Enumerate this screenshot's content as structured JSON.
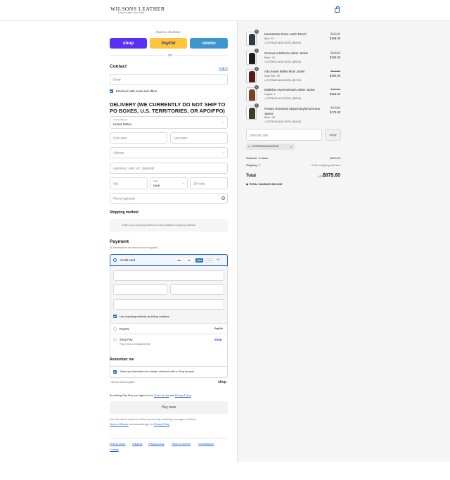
{
  "header": {
    "brand": "WILSONS LEATHER",
    "tagline": "Leather Made. Since 1899"
  },
  "express": {
    "title": "Express checkout",
    "shop": "shop",
    "paypal": "PayPal",
    "venmo": "venmo",
    "or": "OR"
  },
  "contact": {
    "title": "Contact",
    "login": "Log in",
    "email_placeholder": "Email",
    "email_news": "Email me with news and offers"
  },
  "delivery": {
    "title_line1": "DELIVERY (WE CURRENTLY DO NOT SHIP TO",
    "title_line2": "PO BOXES, U.S. TERRITORIES, OR APO/FPO)",
    "country_label": "Country/Region",
    "country_value": "United States",
    "first_name": "First name",
    "last_name": "Last name",
    "address": "Address",
    "apartment": "Apartment, suite, etc. (optional)",
    "city": "City",
    "state_label": "State",
    "state_value": "Iowa",
    "zip": "ZIP code",
    "phone": "Phone (optional)"
  },
  "shipping_method": {
    "title": "Shipping method",
    "note": "Enter your shipping address to view available shipping methods."
  },
  "payment": {
    "title": "Payment",
    "subtitle": "All transactions are secure and encrypted.",
    "credit_card": "Credit card",
    "more_cards": "+3",
    "cards": [
      "VISA",
      "MC",
      "AMEX",
      "DISC"
    ],
    "billing_same": "Use shipping address as billing address",
    "paypal": "PayPal",
    "paypal_logo": "PayPal",
    "shop_pay": "Shop Pay",
    "shop_pay_sub": "Pay in full or in installments",
    "shop_logo": "shop"
  },
  "remember": {
    "title": "Remember me",
    "save_info": "Save my information for a faster checkout with a Shop account",
    "secure": "Secure and encrypted",
    "shop_logo": "shop"
  },
  "agree": {
    "prefix": "By clicking Pay Now, you agree to our",
    "terms": "Terms of Use",
    "and": "and",
    "privacy": "Privacy Policy",
    "end": "."
  },
  "pay_now": "Pay now",
  "shop_note": {
    "line1": "Your info will be saved to a Shop account. By continuing, you agree to Shop's",
    "terms": "Terms of Service",
    "mid": "and acknowledge the",
    "privacy": "Privacy Policy",
    "end": "."
  },
  "footer_links": [
    "Refund policy",
    "Shipping",
    "Privacy policy",
    "Terms of service",
    "Cancellations",
    "Contact"
  ],
  "order": {
    "items": [
      {
        "qty": "1",
        "name": "Nora Button Down Lamb Trench",
        "variant": "Blue / XS",
        "discount": "EXTRA20-WLACCESS (-$49.50)",
        "original": "$247.50",
        "price": "$198.00",
        "color": "#2f3a4a"
      },
      {
        "qty": "1",
        "name": "Genevieve Belted Leather Jacket",
        "variant": "Black / XS",
        "discount": "EXTRA20-WLACCESS (-$39.50)",
        "original": "$197.50",
        "price": "$158.00",
        "color": "#1d1d1d"
      },
      {
        "qty": "1",
        "name": "Ada Suede Belted Moto Jacket",
        "variant": "Deep Red / XS",
        "discount": "EXTRA20-WLACCESS (-$47.50)",
        "original": "$237.50",
        "price": "$190.00",
        "color": "#5a1a1a"
      },
      {
        "qty": "1",
        "name": "Madeline Asymmetrical Leather Jacket",
        "variant": "Cognac / L",
        "discount": "EXTRA20-WLACCESS (-$38.90)",
        "original": "$194.50",
        "price": "$155.60",
        "color": "#7a4326"
      },
      {
        "qty": "1",
        "name": "Presley Oversized Striped Boyfriend Racer Jacket",
        "variant": "Black / XS",
        "discount": "EXTRA20-WLACCESS (-$44.50)",
        "original": "$222.50",
        "price": "$178.00",
        "color": "#3a3d2e"
      }
    ],
    "discount_placeholder": "Discount code",
    "apply": "Apply",
    "code_tag": "EXTRA20-WLACCESS",
    "subtotal_label": "Subtotal · 5 items",
    "subtotal_value": "$879.60",
    "shipping_label": "Shipping",
    "shipping_value": "Enter shipping address",
    "total_label": "Total",
    "currency": "USD",
    "total_value": "$879.60",
    "savings_label": "TOTAL SAVINGS",
    "savings_value": "$219.90"
  }
}
